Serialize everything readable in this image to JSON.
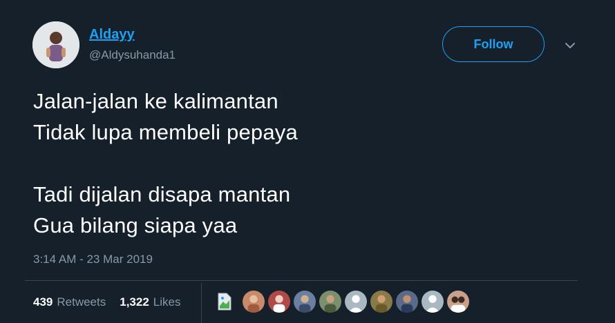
{
  "user": {
    "display_name": "Aldayy",
    "handle": "@Aldysuhanda1",
    "avatar_icon": "user-avatar-photo"
  },
  "follow_button": {
    "label": "Follow"
  },
  "menu_caret": {
    "icon": "chevron-down-icon"
  },
  "tweet": {
    "lines": [
      "Jalan-jalan ke kalimantan",
      "Tidak lupa membeli pepaya",
      "",
      "Tadi dijalan disapa mantan",
      "Gua bilang siapa yaa"
    ],
    "timestamp": "3:14 AM - 23 Mar 2019"
  },
  "stats": {
    "retweets_count": "439",
    "retweets_label": "Retweets",
    "likes_count": "1,322",
    "likes_label": "Likes"
  },
  "likers": [
    {
      "icon": "broken-image-icon"
    },
    {
      "icon": "liker-avatar",
      "color": "#c98a6b"
    },
    {
      "icon": "liker-avatar",
      "color": "#b04a4a"
    },
    {
      "icon": "liker-avatar",
      "color": "#6b7fa0"
    },
    {
      "icon": "liker-avatar",
      "color": "#7a8f6b"
    },
    {
      "icon": "default-avatar",
      "color": "#aab8c2"
    },
    {
      "icon": "liker-avatar",
      "color": "#8a7a4a"
    },
    {
      "icon": "liker-avatar",
      "color": "#5a6b8a"
    },
    {
      "icon": "default-avatar",
      "color": "#aab8c2"
    },
    {
      "icon": "liker-avatar",
      "color": "#c9a08a"
    }
  ],
  "colors": {
    "background": "#15202b",
    "accent": "#1da1f2",
    "secondary_text": "#8899a6",
    "divider": "#38444d"
  }
}
